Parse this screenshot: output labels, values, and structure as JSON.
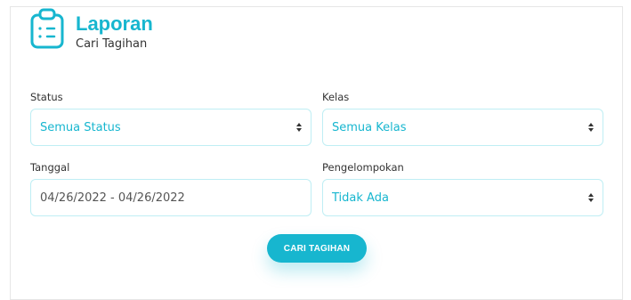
{
  "header": {
    "title": "Laporan",
    "subtitle": "Cari Tagihan",
    "icon": "clipboard-list-icon"
  },
  "form": {
    "status": {
      "label": "Status",
      "value": "Semua Status"
    },
    "kelas": {
      "label": "Kelas",
      "value": "Semua Kelas"
    },
    "tanggal": {
      "label": "Tanggal",
      "value": "04/26/2022 - 04/26/2022"
    },
    "pengelompokan": {
      "label": "Pengelompokan",
      "value": "Tidak Ada"
    }
  },
  "actions": {
    "submit_label": "CARI TAGIHAN"
  },
  "colors": {
    "accent": "#17b6cf",
    "border": "#bfeef4"
  }
}
